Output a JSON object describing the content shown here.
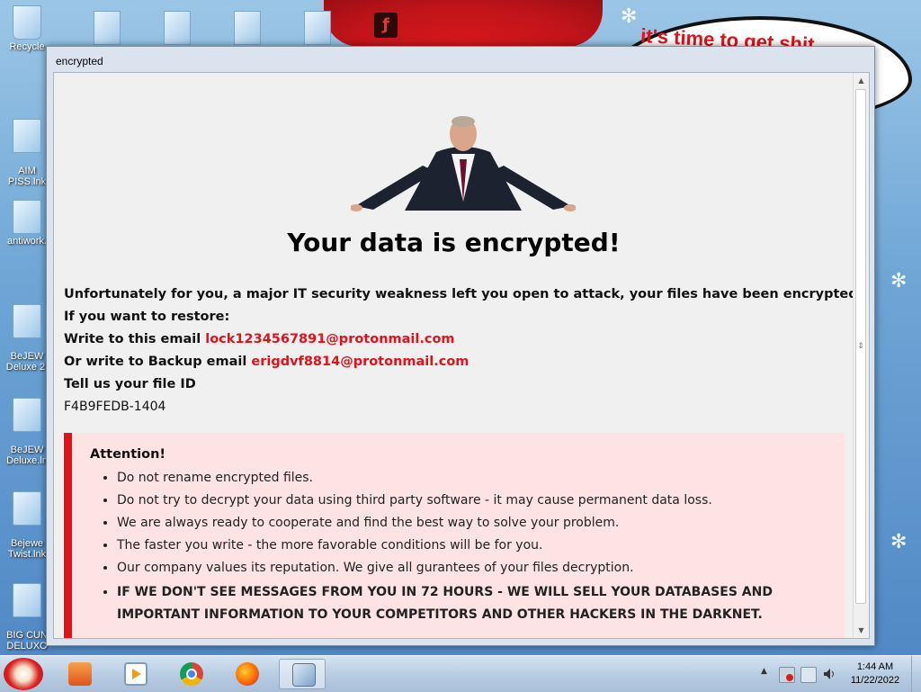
{
  "desktop": {
    "bubble_text": "it's time to get shit",
    "icons": [
      {
        "label": "Recycle"
      },
      {
        "label": "AIM\nPISS.lnk"
      },
      {
        "label": "antiwork."
      },
      {
        "label": "BeJEW\nDeluxe 2."
      },
      {
        "label": "BeJEW\nDeluxe.ln"
      },
      {
        "label": "Bejewe\nTwist.lnk"
      },
      {
        "label": "BIG CUN\nDELUXO"
      }
    ]
  },
  "window": {
    "title": "encrypted",
    "headline": "Your data is encrypted!",
    "intro": "Unfortunately for you, a major IT security weakness left you open to attack, your files have been encrypted",
    "restore_label": "If you want to restore:",
    "email_label": "Write to this email",
    "email": "lock1234567891@protonmail.com",
    "backup_label": "Or write to Backup email",
    "backup_email": "erigdvf8814@protonmail.com",
    "file_id_label": "Tell us your file ID",
    "file_id": "F4B9FEDB-1404",
    "attention": {
      "title": "Attention!",
      "items": [
        "Do not rename encrypted files.",
        "Do not try to decrypt your data using third party software - it may cause permanent data loss.",
        "We are always ready to cooperate and find the best way to solve your problem.",
        "The faster you write - the more favorable conditions will be for you.",
        "Our company values its reputation. We give all gurantees of your files decryption.",
        "IF WE DON'T SEE MESSAGES FROM YOU IN 72 HOURS - WE WILL SELL YOUR DATABASES AND IMPORTANT INFORMATION TO YOUR COMPETITORS AND OTHER HACKERS IN THE DARKNET."
      ]
    }
  },
  "taskbar": {
    "apps": [
      "start-santa-icon",
      "folder-icon",
      "media-player-icon",
      "chrome-icon",
      "firefox-icon",
      "network-app-icon"
    ],
    "clock_time": "1:44 AM",
    "clock_date": "11/22/2022"
  },
  "colors": {
    "accent_red": "#e0121a",
    "attention_bg": "#fde3e3"
  }
}
